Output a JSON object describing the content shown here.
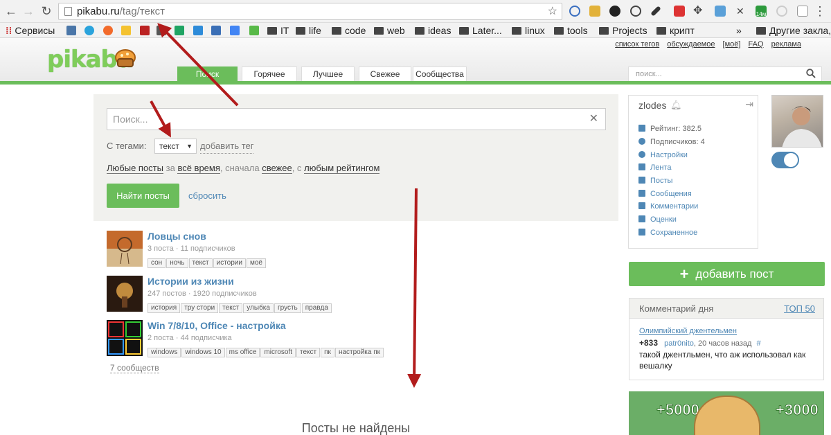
{
  "browser": {
    "url_host": "pikabu.ru",
    "url_path": "/tag/текст",
    "bookmarks": [
      {
        "label": "Сервисы",
        "type": "apps"
      },
      {
        "label": "IT",
        "type": "folder"
      },
      {
        "label": "life",
        "type": "folder"
      },
      {
        "label": "code",
        "type": "folder"
      },
      {
        "label": "web",
        "type": "folder"
      },
      {
        "label": "ideas",
        "type": "folder"
      },
      {
        "label": "Later...",
        "type": "folder"
      },
      {
        "label": "linux",
        "type": "folder"
      },
      {
        "label": "tools",
        "type": "folder"
      },
      {
        "label": "Projects",
        "type": "folder"
      },
      {
        "label": "крипт",
        "type": "folder"
      },
      {
        "label": "»",
        "type": "more"
      },
      {
        "label": "Другие закла,",
        "type": "folder"
      }
    ],
    "extension_badge": "14м"
  },
  "header": {
    "logo": "pikabu",
    "top_links": [
      "список тегов",
      "обсуждаемое",
      "[моё]",
      "FAQ",
      "реклама"
    ],
    "tabs": [
      "Поиск",
      "Горячее",
      "Лучшее",
      "Свежее",
      "Сообщества"
    ],
    "search_placeholder": "поиск..."
  },
  "search": {
    "placeholder": "Поиск...",
    "tags_label": "С тегами:",
    "selected_tag": "текст",
    "add_tag": "добавить тег",
    "filter": {
      "any_posts": "Любые посты",
      "for": "за",
      "all_time": "всё время",
      "sort_first": ", сначала",
      "fresh": "свежее",
      "with": ", с",
      "rating": "любым рейтингом"
    },
    "find_button": "Найти посты",
    "reset": "сбросить"
  },
  "communities": [
    {
      "title": "Ловцы снов",
      "posts": "3 поста",
      "subs": "11 подписчиков",
      "tags": [
        "сон",
        "ночь",
        "текст",
        "истории",
        "моё"
      ]
    },
    {
      "title": "Истории из жизни",
      "posts": "247 постов",
      "subs": "1920 подписчиков",
      "tags": [
        "история",
        "тру стори",
        "текст",
        "улыбка",
        "грусть",
        "правда"
      ]
    },
    {
      "title": "Win 7/8/10, Office - настройка",
      "posts": "2 поста",
      "subs": "44 подписчика",
      "tags": [
        "windows",
        "windows 10",
        "ms office",
        "microsoft",
        "текст",
        "пк",
        "настройка пк"
      ]
    }
  ],
  "communities_count": "7 сообществ",
  "no_posts": "Посты не найдены",
  "user": {
    "name": "zlodes",
    "menu": [
      {
        "label": "Рейтинг: 382.5",
        "kind": "stat"
      },
      {
        "label": "Подписчиков: 4",
        "kind": "stat"
      },
      {
        "label": "Настройки",
        "kind": "link"
      },
      {
        "label": "Лента",
        "kind": "link"
      },
      {
        "label": "Посты",
        "kind": "link"
      },
      {
        "label": "Сообщения",
        "kind": "link"
      },
      {
        "label": "Комментарии",
        "kind": "link"
      },
      {
        "label": "Оценки",
        "kind": "link"
      },
      {
        "label": "Сохраненное",
        "kind": "link"
      }
    ]
  },
  "add_post": "добавить пост",
  "comment_of_day": {
    "title": "Комментарий дня",
    "top": "ТОП 50",
    "post": "Олимпийский джентельмен",
    "score": "+833",
    "author": "patr0nito",
    "time": "20 часов назад",
    "hash": "#",
    "text": "такой джентльмен, что аж использовал как вешалку"
  },
  "banner": {
    "left_points": "+5000",
    "right_points": "+3000"
  },
  "colors": {
    "accent_green": "#6bbd5b",
    "link_blue": "#4e87b5",
    "arrow_red": "#b21c1c"
  }
}
